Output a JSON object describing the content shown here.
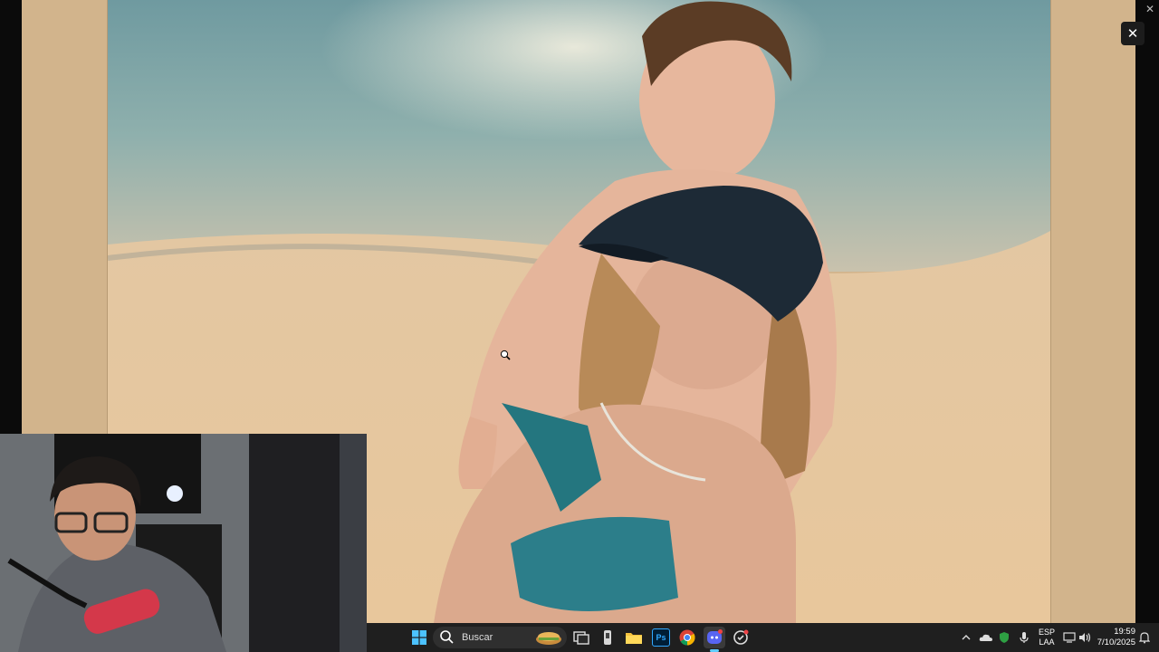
{
  "viewer": {
    "close_label": "✕",
    "window_close_label": "✕"
  },
  "taskbar": {
    "search_placeholder": "Buscar",
    "apps": [
      "start-icon",
      "search-icon",
      "widgets-icon",
      "task-view-icon",
      "app-icon",
      "file-explorer-icon",
      "photoshop-icon",
      "chrome-icon",
      "discord-icon",
      "app-icon"
    ],
    "photoshop_label": "Ps",
    "language_line1": "ESP",
    "language_line2": "LAA",
    "time": "19:59",
    "date": "7/10/2025"
  },
  "colors": {
    "frame": "#d2b48c",
    "taskbar": "#1f1f1f",
    "accent": "#0078d4"
  }
}
